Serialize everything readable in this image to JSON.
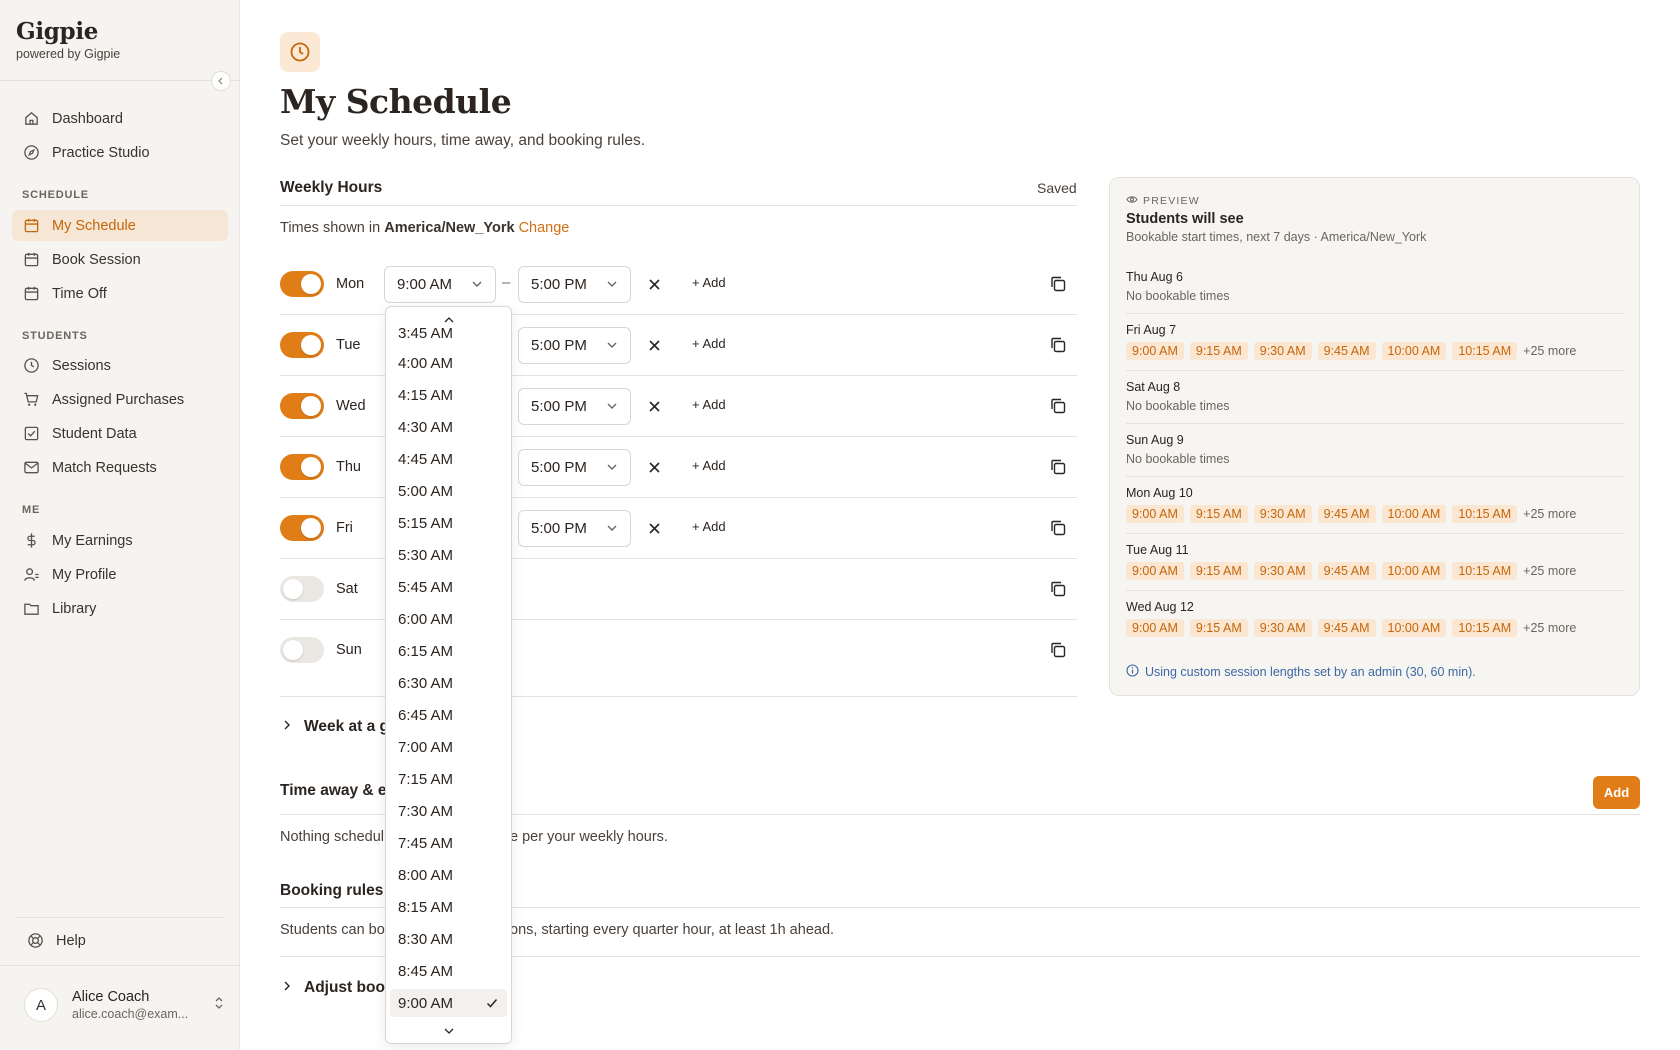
{
  "brand": {
    "name": "Gigpie",
    "sub": "powered by Gigpie"
  },
  "sidebar": {
    "top": [
      {
        "label": "Dashboard",
        "icon": "home-icon"
      },
      {
        "label": "Practice Studio",
        "icon": "compass-icon"
      }
    ],
    "schedule_heading": "SCHEDULE",
    "schedule": [
      {
        "label": "My Schedule",
        "icon": "calendar-icon",
        "active": true
      },
      {
        "label": "Book Session",
        "icon": "calendar-icon"
      },
      {
        "label": "Time Off",
        "icon": "calendar-icon"
      }
    ],
    "students_heading": "STUDENTS",
    "students": [
      {
        "label": "Sessions",
        "icon": "clock-icon"
      },
      {
        "label": "Assigned Purchases",
        "icon": "cart-icon"
      },
      {
        "label": "Student Data",
        "icon": "checkbox-icon"
      },
      {
        "label": "Match Requests",
        "icon": "mail-icon"
      }
    ],
    "me_heading": "ME",
    "me": [
      {
        "label": "My Earnings",
        "icon": "dollar-icon"
      },
      {
        "label": "My Profile",
        "icon": "user-icon"
      },
      {
        "label": "Library",
        "icon": "folder-icon"
      }
    ],
    "help": "Help",
    "user": {
      "initial": "A",
      "name": "Alice Coach",
      "email": "alice.coach@exam..."
    }
  },
  "page": {
    "title": "My Schedule",
    "subtitle": "Set your weekly hours, time away, and booking rules."
  },
  "weekly": {
    "heading": "Weekly Hours",
    "status": "Saved",
    "tz_prefix": "Times shown in",
    "tz": "America/New_York",
    "tz_change": "Change",
    "days": [
      {
        "label": "Mon",
        "on": true,
        "start": "9:00 AM",
        "end": "5:00 PM",
        "add": "+ Add"
      },
      {
        "label": "Tue",
        "on": true,
        "end": "5:00 PM",
        "add": "+ Add"
      },
      {
        "label": "Wed",
        "on": true,
        "end": "5:00 PM",
        "add": "+ Add"
      },
      {
        "label": "Thu",
        "on": true,
        "end": "5:00 PM",
        "add": "+ Add"
      },
      {
        "label": "Fri",
        "on": true,
        "end": "5:00 PM",
        "add": "+ Add"
      },
      {
        "label": "Sat",
        "on": false
      },
      {
        "label": "Sun",
        "on": false
      }
    ],
    "glance": "Week at a g"
  },
  "time_away": {
    "heading": "Time away & ex",
    "add_label": "Add",
    "empty_a": "Nothing schedul",
    "empty_b": "e per your weekly hours."
  },
  "booking": {
    "heading": "Booking rules",
    "text_a": "Students can bo",
    "text_b": "ons, starting every quarter hour, at least 1h ahead.",
    "adjust": "Adjust bool"
  },
  "dropdown": {
    "partial_top": "3:45 AM",
    "options": [
      "4:00 AM",
      "4:15 AM",
      "4:30 AM",
      "4:45 AM",
      "5:00 AM",
      "5:15 AM",
      "5:30 AM",
      "5:45 AM",
      "6:00 AM",
      "6:15 AM",
      "6:30 AM",
      "6:45 AM",
      "7:00 AM",
      "7:15 AM",
      "7:30 AM",
      "7:45 AM",
      "8:00 AM",
      "8:15 AM",
      "8:30 AM",
      "8:45 AM",
      "9:00 AM"
    ],
    "selected": "9:00 AM"
  },
  "preview": {
    "tag": "PREVIEW",
    "title": "Students will see",
    "subtitle": "Bookable start times, next 7 days · America/New_York",
    "days": [
      {
        "name": "Thu Aug 6",
        "none": "No bookable times"
      },
      {
        "name": "Fri Aug 7",
        "slots": [
          "9:00 AM",
          "9:15 AM",
          "9:30 AM",
          "9:45 AM",
          "10:00 AM",
          "10:15 AM"
        ],
        "more": "+25 more"
      },
      {
        "name": "Sat Aug 8",
        "none": "No bookable times"
      },
      {
        "name": "Sun Aug 9",
        "none": "No bookable times"
      },
      {
        "name": "Mon Aug 10",
        "slots": [
          "9:00 AM",
          "9:15 AM",
          "9:30 AM",
          "9:45 AM",
          "10:00 AM",
          "10:15 AM"
        ],
        "more": "+25 more"
      },
      {
        "name": "Tue Aug 11",
        "slots": [
          "9:00 AM",
          "9:15 AM",
          "9:30 AM",
          "9:45 AM",
          "10:00 AM",
          "10:15 AM"
        ],
        "more": "+25 more"
      },
      {
        "name": "Wed Aug 12",
        "slots": [
          "9:00 AM",
          "9:15 AM",
          "9:30 AM",
          "9:45 AM",
          "10:00 AM",
          "10:15 AM"
        ],
        "more": "+25 more"
      }
    ],
    "note": "Using custom session lengths set by an admin (30, 60 min)."
  },
  "colors": {
    "accent": "#e07d17",
    "accent_text": "#c5660a",
    "info": "#3c68a5"
  }
}
